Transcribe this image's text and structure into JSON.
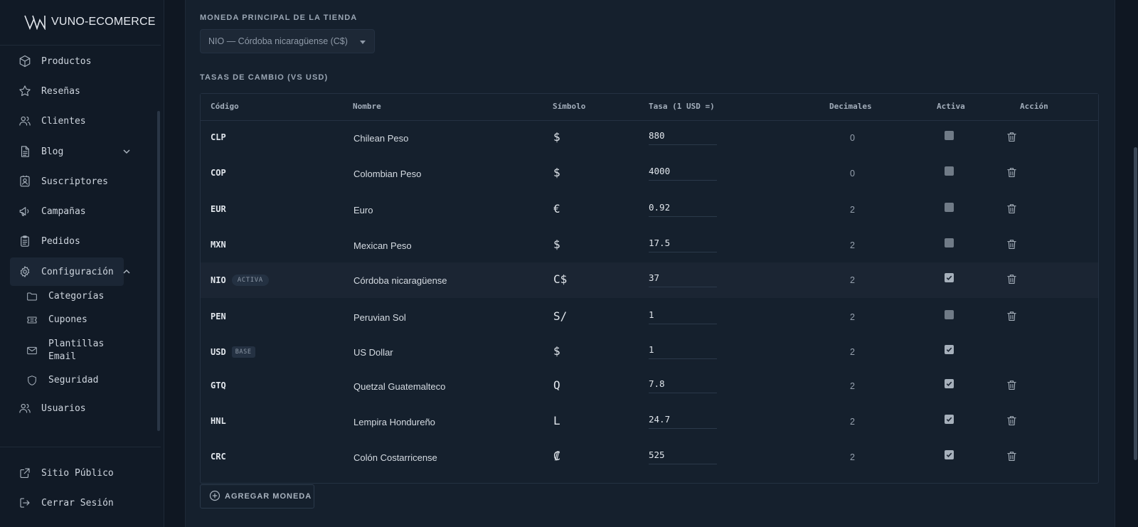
{
  "brand": {
    "name_bold": "VUNO",
    "name_rest": "-ECOMERCE",
    "icon": "vuno-logo-icon"
  },
  "sidebar": {
    "items": [
      {
        "label": "Productos",
        "icon": "cube-icon"
      },
      {
        "label": "Reseñas",
        "icon": "star-icon"
      },
      {
        "label": "Clientes",
        "icon": "users-icon"
      },
      {
        "label": "Blog",
        "icon": "document-icon"
      },
      {
        "label": "Suscriptores",
        "icon": "contact-card-icon"
      },
      {
        "label": "Campañas",
        "icon": "megaphone-icon"
      },
      {
        "label": "Pedidos",
        "icon": "clipboard-icon"
      },
      {
        "label": "Configuración",
        "icon": "gear-icon"
      }
    ],
    "config_sub": [
      {
        "label": "Categorías",
        "icon": "folder-icon"
      },
      {
        "label": "Cupones",
        "icon": "ticket-icon"
      },
      {
        "label": "Plantillas\nEmail",
        "icon": "mail-icon"
      },
      {
        "label": "Seguridad",
        "icon": "shield-icon"
      }
    ],
    "users": {
      "label": "Usuarios",
      "icon": "users-icon"
    },
    "footer": [
      {
        "label": "Sitio Público",
        "icon": "external-link-icon"
      },
      {
        "label": "Cerrar Sesión",
        "icon": "logout-icon"
      }
    ]
  },
  "main": {
    "currency_label": "MONEDA PRINCIPAL DE LA TIENDA",
    "currency_selected": "NIO — Córdoba nicaragüense (C$)",
    "rates_label": "TASAS DE CAMBIO (VS USD)",
    "columns": [
      "Código",
      "Nombre",
      "Símbolo",
      "Tasa (1 USD =)",
      "Decimales",
      "Activa",
      "Acción"
    ],
    "rows": [
      {
        "code": "CLP",
        "badge": "",
        "name": "Chilean Peso",
        "symbol": "$",
        "rate": "880",
        "decimals": "0",
        "active": false,
        "deletable": true
      },
      {
        "code": "COP",
        "badge": "",
        "name": "Colombian Peso",
        "symbol": "$",
        "rate": "4000",
        "decimals": "0",
        "active": false,
        "deletable": true
      },
      {
        "code": "EUR",
        "badge": "",
        "name": "Euro",
        "symbol": "€",
        "rate": "0.92",
        "decimals": "2",
        "active": false,
        "deletable": true
      },
      {
        "code": "MXN",
        "badge": "",
        "name": "Mexican Peso",
        "symbol": "$",
        "rate": "17.5",
        "decimals": "2",
        "active": false,
        "deletable": true
      },
      {
        "code": "NIO",
        "badge": "ACTIVA",
        "name": "Córdoba nicaragüense",
        "symbol": "C$",
        "rate": "37",
        "decimals": "2",
        "active": true,
        "deletable": true
      },
      {
        "code": "PEN",
        "badge": "",
        "name": "Peruvian Sol",
        "symbol": "S/",
        "rate": "1",
        "decimals": "2",
        "active": false,
        "deletable": true
      },
      {
        "code": "USD",
        "badge": "BASE",
        "name": "US Dollar",
        "symbol": "$",
        "rate": "1",
        "decimals": "2",
        "active": true,
        "deletable": false
      },
      {
        "code": "GTQ",
        "badge": "",
        "name": "Quetzal Guatemalteco",
        "symbol": "Q",
        "rate": "7.8",
        "decimals": "2",
        "active": true,
        "deletable": true
      },
      {
        "code": "HNL",
        "badge": "",
        "name": "Lempira Hondureño",
        "symbol": "L",
        "rate": "24.7",
        "decimals": "2",
        "active": true,
        "deletable": true
      },
      {
        "code": "CRC",
        "badge": "",
        "name": "Colón Costarricense",
        "symbol": "₡",
        "rate": "525",
        "decimals": "2",
        "active": true,
        "deletable": true
      }
    ],
    "add_button": "AGREGAR MONEDA"
  },
  "colors": {
    "background": "#0f1722",
    "panel": "#15202d",
    "accent_text": "#e1e6ec",
    "muted": "#9aa6b4"
  }
}
